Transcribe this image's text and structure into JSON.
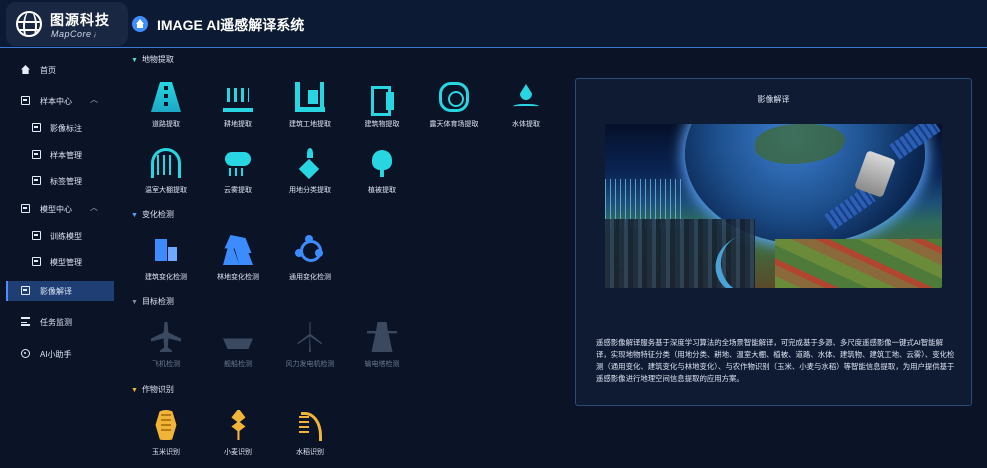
{
  "logo": {
    "cn": "图源科技",
    "en": "MapCore ᵢ"
  },
  "app_title": "IMAGE AI遥感解译系统",
  "sidebar": {
    "items": [
      {
        "label": "首页",
        "level": 0,
        "icon": "home-icon"
      },
      {
        "label": "样本中心",
        "level": 0,
        "icon": "sample-center-icon",
        "expanded": true
      },
      {
        "label": "影像标注",
        "level": 1,
        "icon": "image-annotate-icon"
      },
      {
        "label": "样本管理",
        "level": 1,
        "icon": "sample-manage-icon"
      },
      {
        "label": "标签管理",
        "level": 1,
        "icon": "tag-manage-icon"
      },
      {
        "label": "模型中心",
        "level": 0,
        "icon": "model-center-icon",
        "expanded": true
      },
      {
        "label": "训练模型",
        "level": 1,
        "icon": "train-model-icon"
      },
      {
        "label": "模型管理",
        "level": 1,
        "icon": "model-manage-icon"
      },
      {
        "label": "影像解译",
        "level": 0,
        "icon": "image-interpret-icon",
        "active": true
      },
      {
        "label": "任务监测",
        "level": 0,
        "icon": "task-monitor-icon"
      },
      {
        "label": "AI小助手",
        "level": 0,
        "icon": "ai-assistant-icon"
      }
    ]
  },
  "sections": {
    "extract": {
      "title": "地物提取",
      "tools": [
        "道路提取",
        "耕地提取",
        "建筑工地提取",
        "建筑物提取",
        "露天体育场提取",
        "水体提取",
        "温室大棚提取",
        "云雾提取",
        "用地分类提取",
        "植被提取"
      ]
    },
    "change": {
      "title": "变化检测",
      "tools": [
        "建筑变化检测",
        "林地变化检测",
        "通用变化检测"
      ]
    },
    "target": {
      "title": "目标检测",
      "tools": [
        "飞机检测",
        "舰船检测",
        "风力发电机检测",
        "输电塔检测"
      ]
    },
    "crop": {
      "title": "作物识别",
      "tools": [
        "玉米识别",
        "小麦识别",
        "水稻识别"
      ]
    }
  },
  "panel": {
    "title": "影像解译",
    "description": "遥感影像解译服务基于深度学习算法的全场景智能解译，可完成基于多源、多尺度遥感影像一键式AI智能解译，实现地物特征分类（用地分类、耕地、温室大棚、植被、道路、水体、建筑物、建筑工地、云雾）、变化检测（通用变化、建筑变化与林地变化）、与农作物识别（玉米、小麦与水稻）等智能信息提取，为用户提供基于遥感影像进行地理空间信息提取的应用方案。"
  },
  "colors": {
    "accent": "#3f8cff",
    "extract": "#27d6e0",
    "change": "#3c8cff",
    "target_disabled": "#3a4860",
    "crop": "#f0b438",
    "background": "#0b1326"
  }
}
